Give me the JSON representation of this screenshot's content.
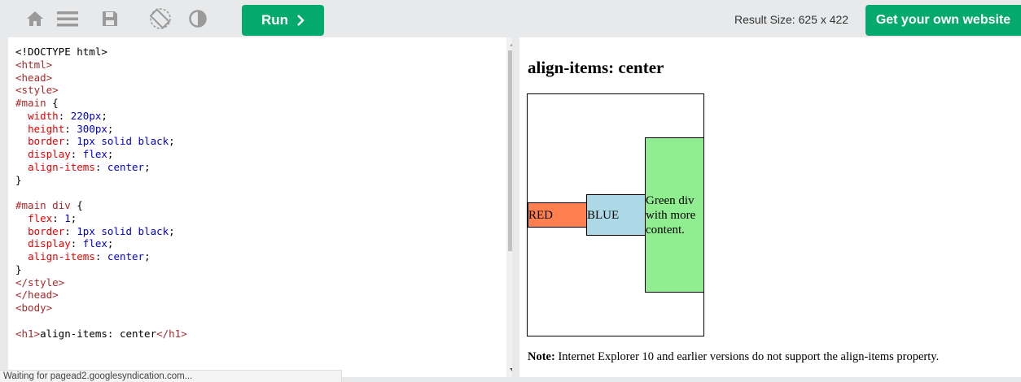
{
  "toolbar": {
    "icons": [
      "home-icon",
      "menu-icon",
      "save-icon",
      "rotate-icon",
      "theme-contrast-icon"
    ],
    "run_label": "Run",
    "result_size_label": "Result Size: 625 x 422",
    "get_website_label": "Get your own website",
    "accent_color": "#04aa6d"
  },
  "code_lines": [
    "<!DOCTYPE html>",
    "<html>",
    "<head>",
    "<style>",
    "#main {",
    "  width: 220px;",
    "  height: 300px;",
    "  border: 1px solid black;",
    "  display: flex;",
    "  align-items: center;",
    "}",
    "",
    "#main div {",
    "  flex: 1;",
    "  border: 1px solid black;",
    "  display: flex;",
    "  align-items: center;",
    "}",
    "</style>",
    "</head>",
    "<body>",
    "",
    "<h1>align-items: center</h1>"
  ],
  "status_bar": "Waiting for pagead2.googlesyndication.com...",
  "result": {
    "title": "align-items: center",
    "red_label": "RED",
    "blue_label": "BLUE",
    "green_label": "Green div with more content.",
    "note_bold": "Note:",
    "note_text": " Internet Explorer 10 and earlier versions do not support the align-items property.",
    "colors": {
      "red": "coral",
      "blue": "lightblue",
      "green": "lightgreen"
    }
  }
}
